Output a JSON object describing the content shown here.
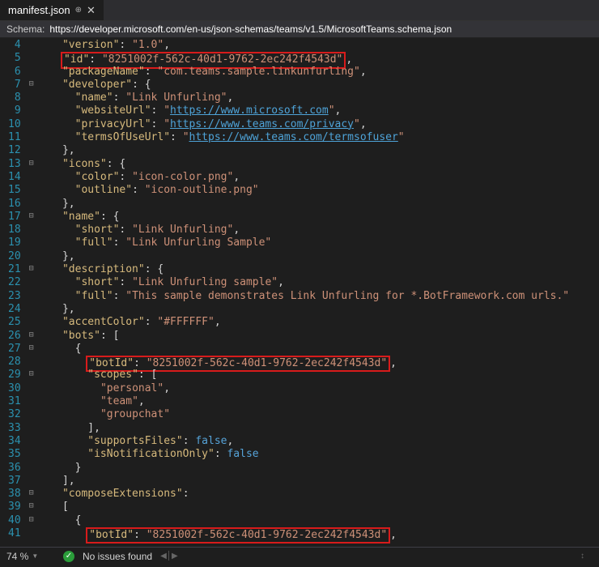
{
  "tab": {
    "filename": "manifest.json"
  },
  "schema": {
    "label": "Schema:",
    "url": "https://developer.microsoft.com/en-us/json-schemas/teams/v1.5/MicrosoftTeams.schema.json"
  },
  "lineNumbers": [
    "4",
    "5",
    "6",
    "7",
    "8",
    "9",
    "10",
    "11",
    "12",
    "13",
    "14",
    "15",
    "16",
    "17",
    "18",
    "19",
    "20",
    "21",
    "22",
    "23",
    "24",
    "25",
    "26",
    "27",
    "28",
    "29",
    "30",
    "31",
    "32",
    "33",
    "34",
    "35",
    "36",
    "37",
    "38",
    "39",
    "40",
    "41"
  ],
  "foldMarks": [
    "",
    "",
    "",
    "⊟",
    "",
    "",
    "",
    "",
    "",
    "⊟",
    "",
    "",
    "",
    "⊟",
    "",
    "",
    "",
    "⊟",
    "",
    "",
    "",
    "",
    "⊟",
    "⊟",
    "",
    "⊟",
    "",
    "",
    "",
    "",
    "",
    "",
    "",
    "",
    "⊟",
    "⊟",
    "⊟",
    ""
  ],
  "code": {
    "l4": {
      "ind": "    ",
      "k": "\"version\"",
      "s": "\"1.0\"",
      "c": ","
    },
    "l5": {
      "ind": "    ",
      "k": "\"id\"",
      "s": "\"8251002f-562c-40d1-9762-2ec242f4543d\"",
      "c": ",",
      "hl": true
    },
    "l6": {
      "ind": "    ",
      "k": "\"packageName\"",
      "s": "\"com.teams.sample.linkunfurling\"",
      "c": ","
    },
    "l7": {
      "ind": "    ",
      "k": "\"developer\"",
      "open": "{"
    },
    "l8": {
      "ind": "      ",
      "k": "\"name\"",
      "s": "\"Link Unfurling\"",
      "c": ","
    },
    "l9": {
      "ind": "      ",
      "k": "\"websiteUrl\"",
      "s": "https://www.microsoft.com",
      "c": ",",
      "url": true
    },
    "l10": {
      "ind": "      ",
      "k": "\"privacyUrl\"",
      "s": "https://www.teams.com/privacy",
      "c": ",",
      "url": true
    },
    "l11": {
      "ind": "      ",
      "k": "\"termsOfUseUrl\"",
      "s": "https://www.teams.com/termsofuser",
      "url": true
    },
    "l12": {
      "ind": "    ",
      "close": "},"
    },
    "l13": {
      "ind": "    ",
      "k": "\"icons\"",
      "open": "{"
    },
    "l14": {
      "ind": "      ",
      "k": "\"color\"",
      "s": "\"icon-color.png\"",
      "c": ","
    },
    "l15": {
      "ind": "      ",
      "k": "\"outline\"",
      "s": "\"icon-outline.png\""
    },
    "l16": {
      "ind": "    ",
      "close": "},"
    },
    "l17": {
      "ind": "    ",
      "k": "\"name\"",
      "open": "{"
    },
    "l18": {
      "ind": "      ",
      "k": "\"short\"",
      "s": "\"Link Unfurling\"",
      "c": ","
    },
    "l19": {
      "ind": "      ",
      "k": "\"full\"",
      "s": "\"Link Unfurling Sample\""
    },
    "l20": {
      "ind": "    ",
      "close": "},"
    },
    "l21": {
      "ind": "    ",
      "k": "\"description\"",
      "open": "{"
    },
    "l22": {
      "ind": "      ",
      "k": "\"short\"",
      "s": "\"Link Unfurling sample\"",
      "c": ","
    },
    "l23": {
      "ind": "      ",
      "k": "\"full\"",
      "s": "\"This sample demonstrates Link Unfurling for *.BotFramework.com urls.\""
    },
    "l24": {
      "ind": "    ",
      "close": "},"
    },
    "l25": {
      "ind": "    ",
      "k": "\"accentColor\"",
      "s": "\"#FFFFFF\"",
      "c": ","
    },
    "l26": {
      "ind": "    ",
      "k": "\"bots\"",
      "open": "["
    },
    "l27": {
      "ind": "      ",
      "close": "{"
    },
    "l28": {
      "ind": "        ",
      "k": "\"botId\"",
      "s": "\"8251002f-562c-40d1-9762-2ec242f4543d\"",
      "c": ",",
      "hl": true
    },
    "l29": {
      "ind": "        ",
      "k": "\"scopes\"",
      "open": "["
    },
    "l30": {
      "ind": "          ",
      "s": "\"personal\"",
      "c": ","
    },
    "l31": {
      "ind": "          ",
      "s": "\"team\"",
      "c": ","
    },
    "l32": {
      "ind": "          ",
      "s": "\"groupchat\""
    },
    "l33": {
      "ind": "        ",
      "close": "],"
    },
    "l34": {
      "ind": "        ",
      "k": "\"supportsFiles\"",
      "lit": "false",
      "c": ","
    },
    "l35": {
      "ind": "        ",
      "k": "\"isNotificationOnly\"",
      "lit": "false"
    },
    "l36": {
      "ind": "      ",
      "close": "}"
    },
    "l37": {
      "ind": "    ",
      "close": "],"
    },
    "l38": {
      "ind": "    ",
      "k": "\"composeExtensions\"",
      "colon": ":"
    },
    "l39": {
      "ind": "    ",
      "close": "["
    },
    "l40": {
      "ind": "      ",
      "close": "{"
    },
    "l41": {
      "ind": "        ",
      "k": "\"botId\"",
      "s": "\"8251002f-562c-40d1-9762-2ec242f4543d\"",
      "c": ",",
      "hl": true
    }
  },
  "status": {
    "zoom": "74 %",
    "issues": "No issues found"
  }
}
